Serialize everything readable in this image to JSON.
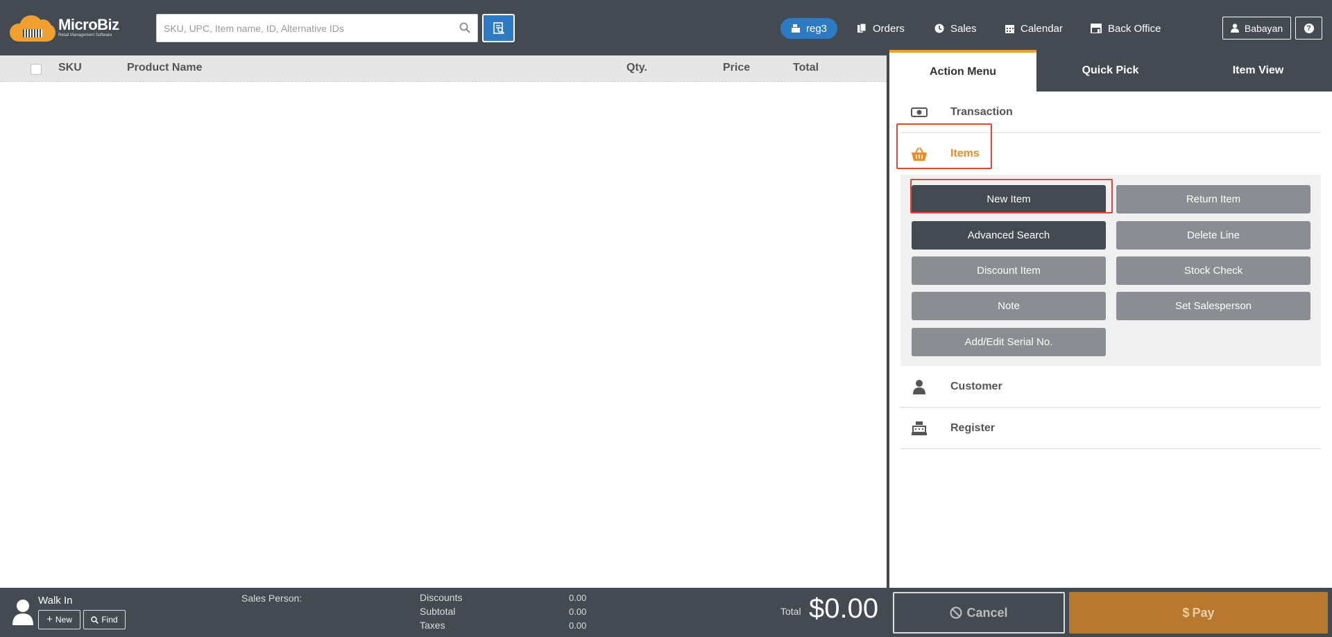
{
  "header": {
    "logo_name": "MicroBiz",
    "logo_tagline": "Retail Management Software",
    "search_placeholder": "SKU, UPC, Item name, ID, Alternative IDs",
    "register_label": "reg3",
    "nav": [
      {
        "label": "Orders",
        "icon": "orders-icon"
      },
      {
        "label": "Sales",
        "icon": "sales-icon"
      },
      {
        "label": "Calendar",
        "icon": "calendar-icon"
      },
      {
        "label": "Back Office",
        "icon": "store-icon"
      }
    ],
    "user_label": "Babayan",
    "help_label": "?"
  },
  "table": {
    "columns": {
      "sku": "SKU",
      "product_name": "Product Name",
      "qty": "Qty.",
      "price": "Price",
      "total": "Total"
    },
    "rows": []
  },
  "right_panel": {
    "tabs": [
      "Action Menu",
      "Quick Pick",
      "Item View"
    ],
    "active_tab": "Action Menu",
    "sections": {
      "transaction": "Transaction",
      "items": "Items",
      "customer": "Customer",
      "register": "Register"
    },
    "item_actions": [
      "New Item",
      "Return Item",
      "Advanced Search",
      "Delete Line",
      "Discount Item",
      "Stock Check",
      "Note",
      "Set Salesperson",
      "Add/Edit Serial No."
    ]
  },
  "footer": {
    "customer_name": "Walk In",
    "new_label": "New",
    "find_label": "Find",
    "salesperson_label": "Sales Person:",
    "discounts_label": "Discounts",
    "discounts_value": "0.00",
    "subtotal_label": "Subtotal",
    "subtotal_value": "0.00",
    "taxes_label": "Taxes",
    "taxes_value": "0.00",
    "total_label": "Total",
    "total_value": "$0.00",
    "cancel_label": "Cancel",
    "pay_label": "Pay"
  },
  "colors": {
    "header_bg": "#444a52",
    "accent_blue": "#2e7bc4",
    "accent_orange": "#f08a20",
    "highlight_red": "#e0453a",
    "pay_bg": "#b8782e"
  }
}
